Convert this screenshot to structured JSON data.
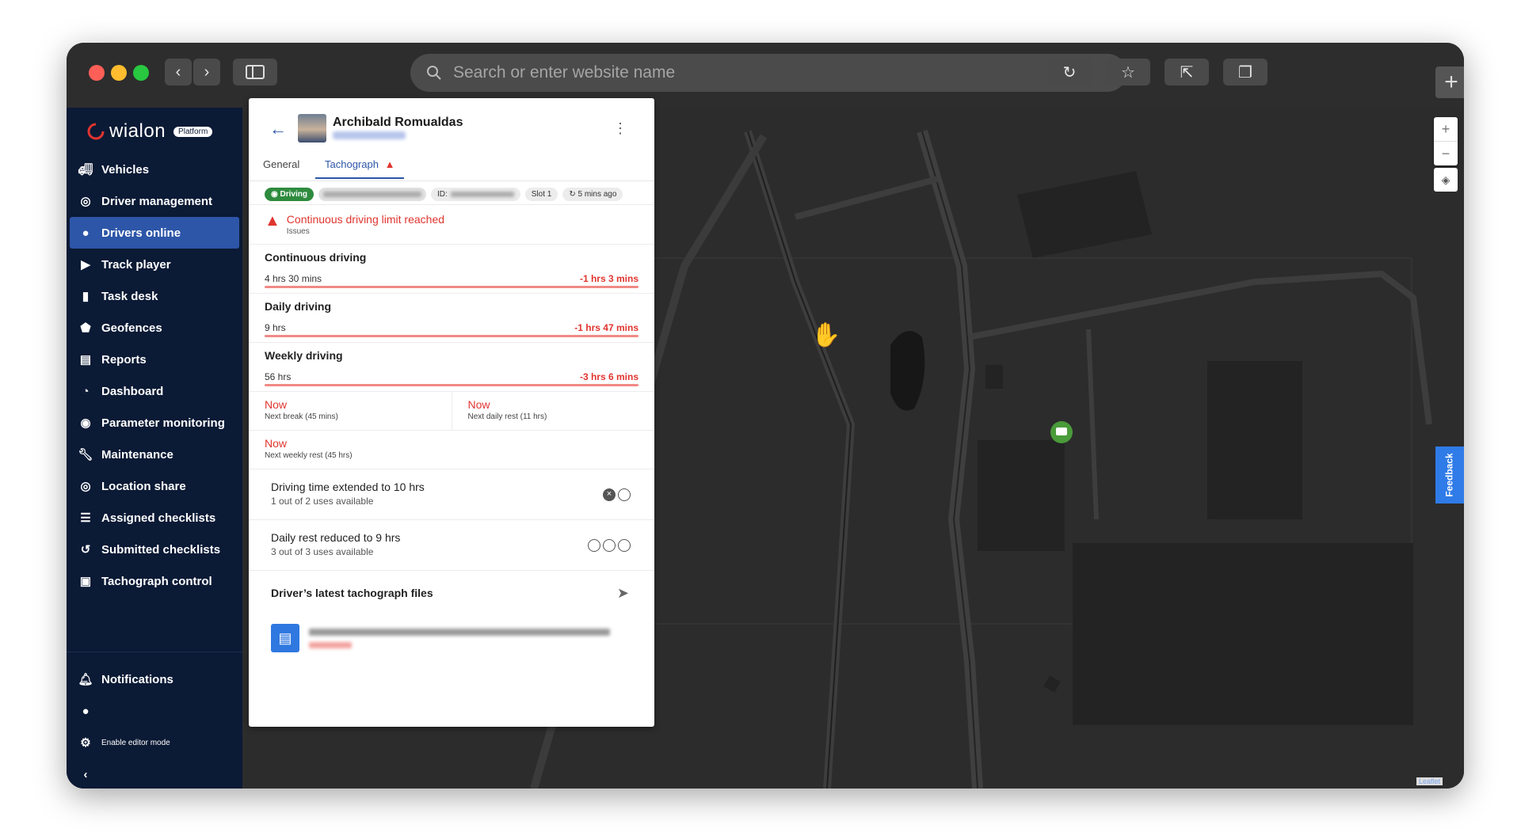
{
  "browser": {
    "address_placeholder": "Search or enter website name",
    "traffic_lights": [
      "#ff5f57",
      "#febc2e",
      "#28c840"
    ]
  },
  "app": {
    "logo_text": "wialon",
    "logo_badge": "Platform",
    "nav": [
      {
        "label": "Vehicles",
        "icon": "truck-icon",
        "active": false
      },
      {
        "label": "Driver management",
        "icon": "steering-wheel-icon",
        "active": false
      },
      {
        "label": "Drivers online",
        "icon": "driver-online-icon",
        "active": true
      },
      {
        "label": "Track player",
        "icon": "play-icon",
        "active": false
      },
      {
        "label": "Task desk",
        "icon": "task-icon",
        "active": false
      },
      {
        "label": "Geofences",
        "icon": "pentagon-icon",
        "active": false
      },
      {
        "label": "Reports",
        "icon": "document-icon",
        "active": false
      },
      {
        "label": "Dashboard",
        "icon": "pie-chart-icon",
        "active": false
      },
      {
        "label": "Parameter monitoring",
        "icon": "signal-icon",
        "active": false
      },
      {
        "label": "Maintenance",
        "icon": "wrench-icon",
        "active": false
      },
      {
        "label": "Location share",
        "icon": "location-share-icon",
        "active": false
      },
      {
        "label": "Assigned checklists",
        "icon": "checklist-icon",
        "active": false
      },
      {
        "label": "Submitted checklists",
        "icon": "history-icon",
        "active": false
      },
      {
        "label": "Tachograph control",
        "icon": "tachograph-icon",
        "active": false
      }
    ],
    "bottom_nav": {
      "notifications": "Notifications",
      "editor_mode": "Enable editor mode"
    }
  },
  "panel": {
    "driver_name": "Archibald Romualdas",
    "tabs": {
      "general": "General",
      "tachograph": "Tachograph"
    },
    "status_chip": "Driving",
    "id_label": "ID:",
    "slot": "Slot 1",
    "updated": "5 mins ago",
    "issue": {
      "title": "Continuous driving limit reached",
      "sub": "Issues"
    },
    "metrics": [
      {
        "title": "Continuous driving",
        "value": "4 hrs 30 mins",
        "delta": "-1 hrs 3 mins"
      },
      {
        "title": "Daily driving",
        "value": "9 hrs",
        "delta": "-1 hrs 47 mins"
      },
      {
        "title": "Weekly driving",
        "value": "56 hrs",
        "delta": "-3 hrs 6 mins"
      }
    ],
    "next": {
      "break_now": "Now",
      "break_sub": "Next break (45 mins)",
      "daily_now": "Now",
      "daily_sub": "Next daily rest (11 hrs)",
      "weekly_now": "Now",
      "weekly_sub": "Next weekly rest (45 hrs)"
    },
    "extensions": [
      {
        "title": "Driving time extended to 10 hrs",
        "sub": "1 out of 2 uses available"
      },
      {
        "title": "Daily rest reduced to 9 hrs",
        "sub": "3 out of 3 uses available"
      }
    ],
    "files_title": "Driver’s latest tachograph files"
  },
  "map": {
    "zoom_in": "+",
    "zoom_out": "−",
    "feedback": "Feedback",
    "attribution": "Leaflet"
  }
}
